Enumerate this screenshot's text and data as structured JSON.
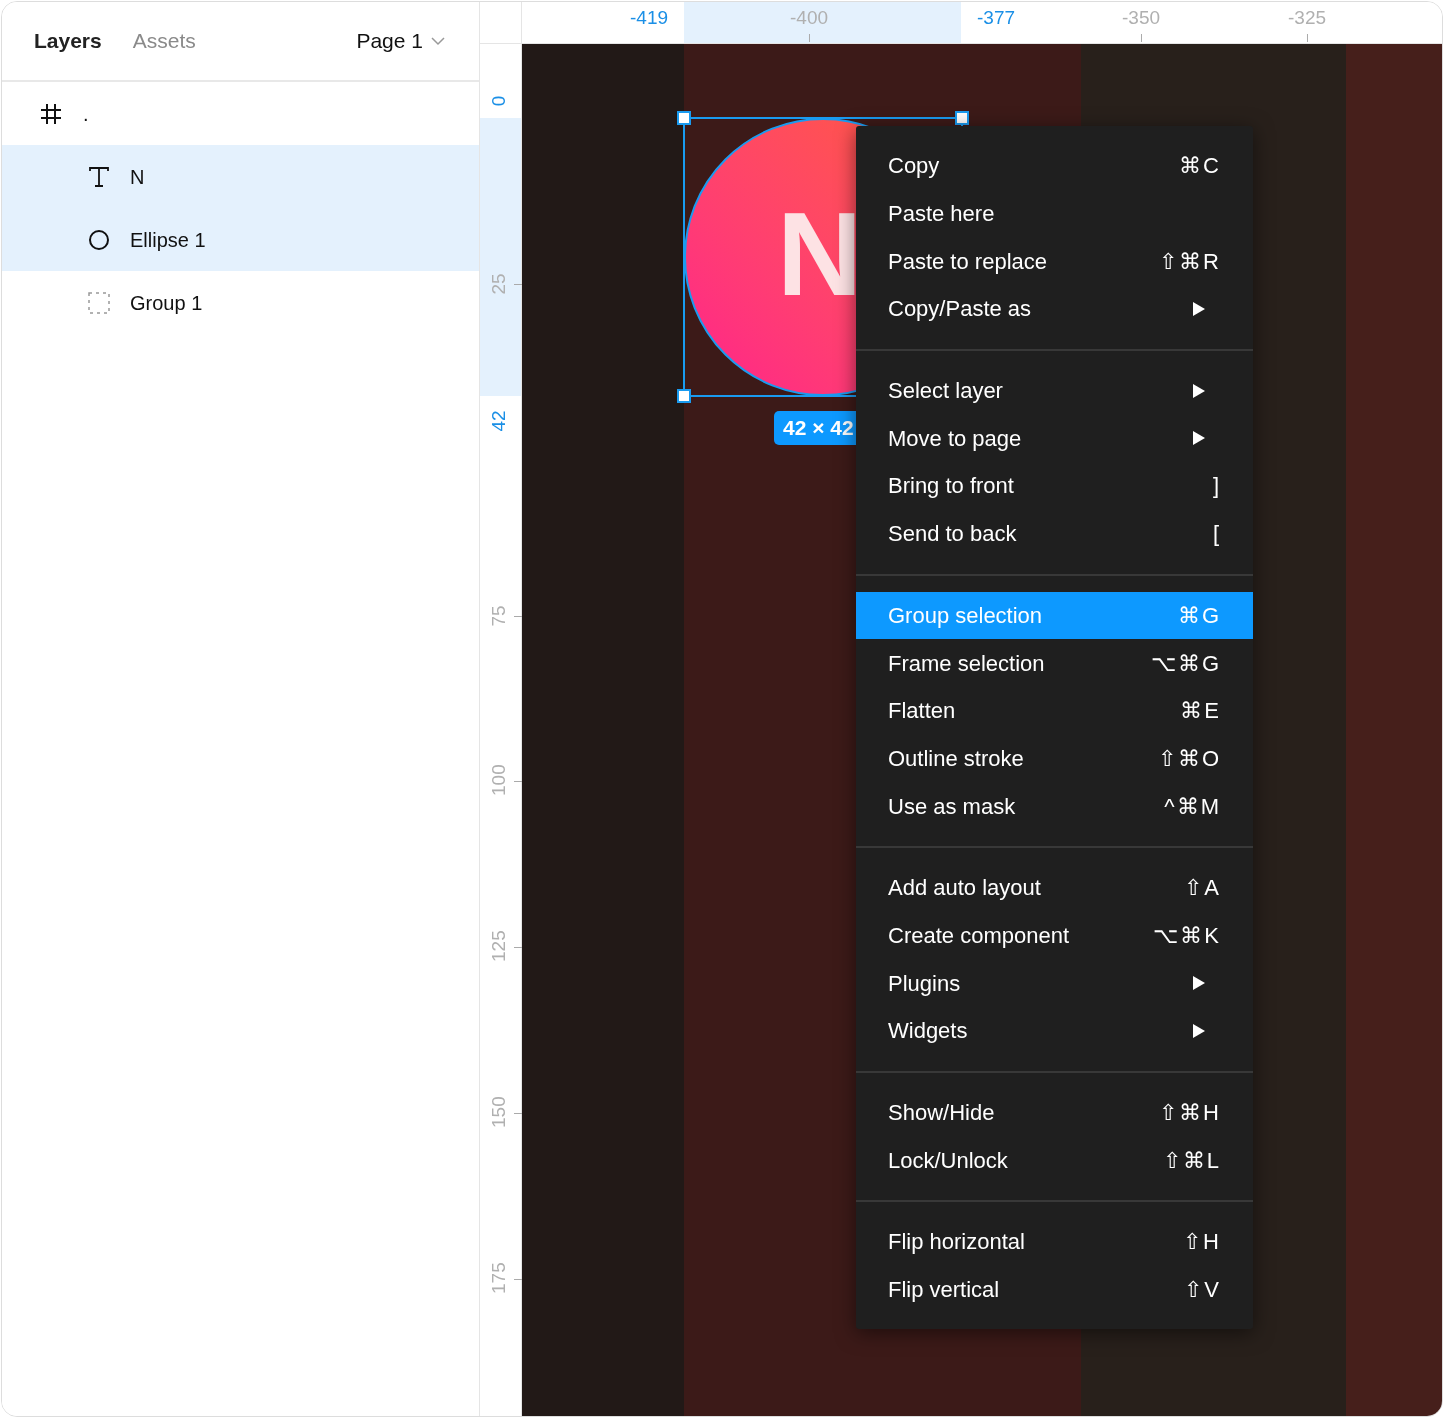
{
  "layers_panel": {
    "tabs": [
      {
        "label": "Layers",
        "selected": true
      },
      {
        "label": "Assets",
        "selected": false
      }
    ],
    "page_selector": "Page 1",
    "layers": [
      {
        "kind": "frame",
        "name": ".",
        "selected": false,
        "children": [
          {
            "kind": "text",
            "name": "N",
            "selected": true
          },
          {
            "kind": "ellipse",
            "name": "Ellipse 1",
            "selected": true
          },
          {
            "kind": "group",
            "name": "Group 1",
            "selected": false
          }
        ]
      }
    ]
  },
  "rulers": {
    "top": [
      {
        "label": "-419",
        "highlighted": true
      },
      {
        "label": "-400",
        "highlighted": false
      },
      {
        "label": "-377",
        "highlighted": true
      },
      {
        "label": "-350",
        "highlighted": false
      },
      {
        "label": "-325",
        "highlighted": false
      }
    ],
    "left": [
      {
        "label": "0",
        "highlighted": true
      },
      {
        "label": "25",
        "highlighted": false
      },
      {
        "label": "42",
        "highlighted": true
      },
      {
        "label": "75",
        "highlighted": false
      },
      {
        "label": "100",
        "highlighted": false
      },
      {
        "label": "125",
        "highlighted": false
      },
      {
        "label": "150",
        "highlighted": false
      },
      {
        "label": "175",
        "highlighted": false
      }
    ]
  },
  "canvas": {
    "text_layer": "N",
    "selection_size": "42 × 42"
  },
  "context_menu": {
    "sections": [
      [
        {
          "label": "Copy",
          "shortcut": "⌘C",
          "submenu": false,
          "selected": false
        },
        {
          "label": "Paste here",
          "submenu": false,
          "selected": false
        },
        {
          "label": "Paste to replace",
          "shortcut": "⇧⌘R",
          "submenu": false,
          "selected": false
        },
        {
          "label": "Copy/Paste as",
          "submenu": true,
          "selected": false
        }
      ],
      [
        {
          "label": "Select layer",
          "submenu": true,
          "selected": false
        },
        {
          "label": "Move to page",
          "submenu": true,
          "selected": false
        },
        {
          "label": "Bring to front",
          "shortcut": "]",
          "submenu": false,
          "selected": false
        },
        {
          "label": "Send to back",
          "shortcut": "[",
          "submenu": false,
          "selected": false
        }
      ],
      [
        {
          "label": "Group selection",
          "shortcut": "⌘G",
          "submenu": false,
          "selected": true
        },
        {
          "label": "Frame selection",
          "shortcut": "⌥⌘G",
          "submenu": false,
          "selected": false
        },
        {
          "label": "Flatten",
          "shortcut": "⌘E",
          "submenu": false,
          "selected": false
        },
        {
          "label": "Outline stroke",
          "shortcut": "⇧⌘O",
          "submenu": false,
          "selected": false
        },
        {
          "label": "Use as mask",
          "shortcut": "^⌘M",
          "submenu": false,
          "selected": false
        }
      ],
      [
        {
          "label": "Add auto layout",
          "shortcut": "⇧A",
          "submenu": false,
          "selected": false
        },
        {
          "label": "Create component",
          "shortcut": "⌥⌘K",
          "submenu": false,
          "selected": false
        },
        {
          "label": "Plugins",
          "submenu": true,
          "selected": false
        },
        {
          "label": "Widgets",
          "submenu": true,
          "selected": false
        }
      ],
      [
        {
          "label": "Show/Hide",
          "shortcut": "⇧⌘H",
          "submenu": false,
          "selected": false
        },
        {
          "label": "Lock/Unlock",
          "shortcut": "⇧⌘L",
          "submenu": false,
          "selected": false
        }
      ],
      [
        {
          "label": "Flip horizontal",
          "shortcut": "⇧H",
          "submenu": false,
          "selected": false
        },
        {
          "label": "Flip vertical",
          "shortcut": "⇧V",
          "submenu": false,
          "selected": false
        }
      ]
    ]
  }
}
